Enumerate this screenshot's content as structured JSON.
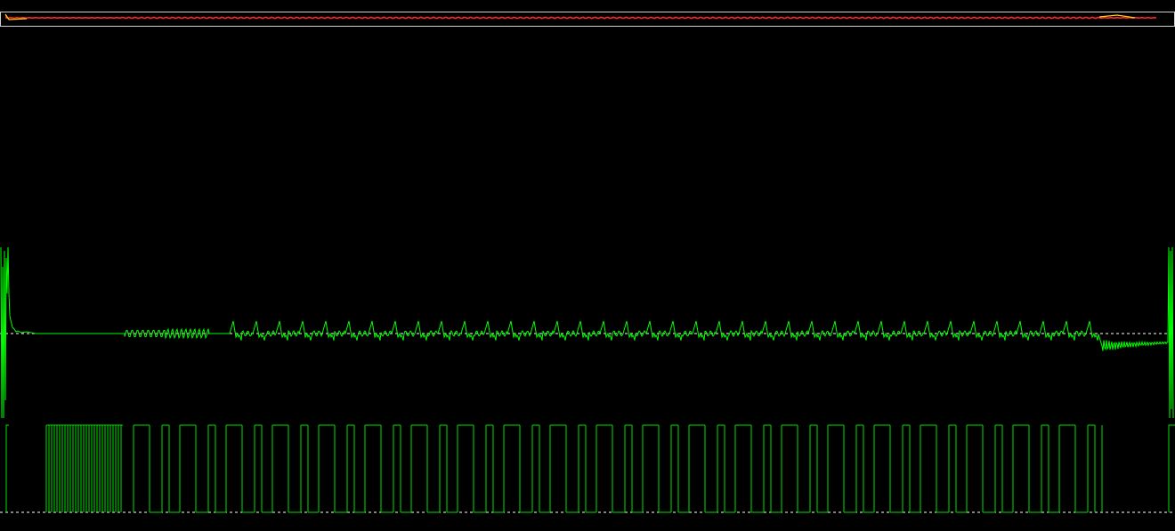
{
  "colors": {
    "background": "#000000",
    "trace": "#00e000",
    "trace_bright": "#00ff00",
    "baseline": "#ffffff",
    "overview_signal": "#ff2a2a",
    "overview_marker": "#ffd21a",
    "overview_border": "#cfcfcf"
  },
  "icons": {
    "overview": "signal-overview-strip",
    "analog": "analog-waveform",
    "digital": "digital-pulse-train"
  },
  "overview": {
    "has_selection_window": true
  },
  "analog_channel": {
    "has_baseline": true
  },
  "digital_channel": {
    "has_baseline": true
  }
}
